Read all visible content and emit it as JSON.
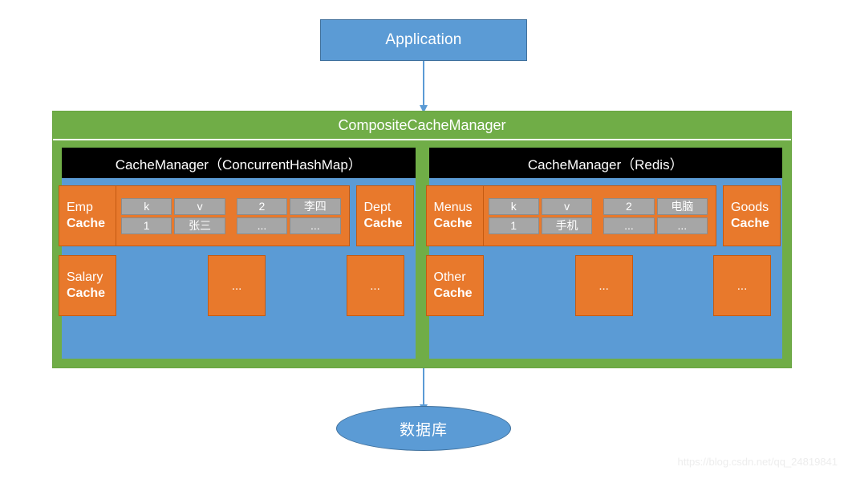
{
  "application": {
    "label": "Application"
  },
  "composite": {
    "title": "CompositeCacheManager"
  },
  "managers": [
    {
      "header": "CacheManager（ConcurrentHashMap）",
      "top_row": {
        "named_cache_left": {
          "line1": "Emp",
          "line2": "Cache"
        },
        "tables": [
          {
            "rows": [
              [
                "k",
                "v"
              ],
              [
                "1",
                "张三"
              ]
            ]
          },
          {
            "rows": [
              [
                "2",
                "李四"
              ],
              [
                "...",
                "..."
              ]
            ]
          }
        ],
        "named_cache_right": {
          "line1": "Dept",
          "line2": "Cache"
        }
      },
      "bottom_row": {
        "named_cache_left": {
          "line1": "Salary",
          "line2": "Cache"
        },
        "placeholders": [
          "...",
          "..."
        ]
      }
    },
    {
      "header": "CacheManager（Redis）",
      "top_row": {
        "named_cache_left": {
          "line1": "Menus",
          "line2": "Cache"
        },
        "tables": [
          {
            "rows": [
              [
                "k",
                "v"
              ],
              [
                "1",
                "手机"
              ]
            ]
          },
          {
            "rows": [
              [
                "2",
                "电脑"
              ],
              [
                "...",
                "..."
              ]
            ]
          }
        ],
        "named_cache_right": {
          "line1": "Goods",
          "line2": "Cache"
        }
      },
      "bottom_row": {
        "named_cache_left": {
          "line1": "Other",
          "line2": "Cache"
        },
        "placeholders": [
          "...",
          "..."
        ]
      }
    }
  ],
  "database": {
    "label": "数据库"
  },
  "watermark": {
    "text": "https://blog.csdn.net/qq_24819841"
  },
  "colors": {
    "green": "#70AD47",
    "blue": "#5B9BD5",
    "orange": "#E8792C",
    "gray": "#A6A6A6",
    "black": "#000000"
  }
}
